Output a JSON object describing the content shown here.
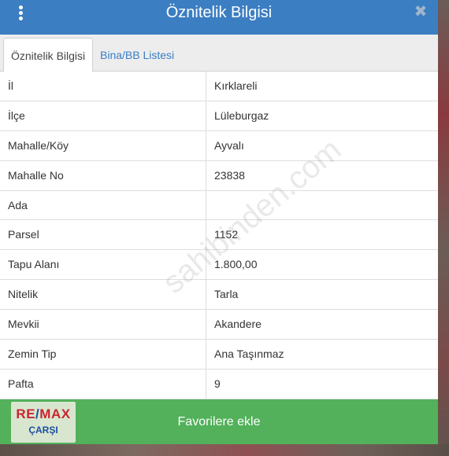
{
  "header": {
    "title": "Öznitelik Bilgisi",
    "menu_icon": "vertical-dots-icon",
    "close_icon": "close-icon",
    "close_glyph": "✖"
  },
  "tabs": [
    {
      "label": "Öznitelik Bilgisi",
      "active": true
    },
    {
      "label": "Bina/BB Listesi",
      "active": false
    }
  ],
  "attributes": [
    {
      "key": "İl",
      "value": "Kırklareli"
    },
    {
      "key": "İlçe",
      "value": "Lüleburgaz"
    },
    {
      "key": "Mahalle/Köy",
      "value": "Ayvalı"
    },
    {
      "key": "Mahalle No",
      "value": "23838"
    },
    {
      "key": "Ada",
      "value": ""
    },
    {
      "key": "Parsel",
      "value": "1152"
    },
    {
      "key": "Tapu Alanı",
      "value": "1.800,00"
    },
    {
      "key": "Nitelik",
      "value": "Tarla"
    },
    {
      "key": "Mevkii",
      "value": "Akandere"
    },
    {
      "key": "Zemin Tip",
      "value": "Ana Taşınmaz"
    },
    {
      "key": "Pafta",
      "value": "9"
    }
  ],
  "footer": {
    "button_label": "Favorilere ekle"
  },
  "logo": {
    "brand_left": "RE",
    "brand_slash": "/",
    "brand_right": "MAX",
    "branch": "ÇARŞI"
  },
  "watermark": "sahibinden.com",
  "colors": {
    "header": "#3b7ec2",
    "tab_link": "#3b7ec2",
    "footer": "#52b15a",
    "logo_red": "#c9252f",
    "logo_blue": "#1c4fa0"
  }
}
